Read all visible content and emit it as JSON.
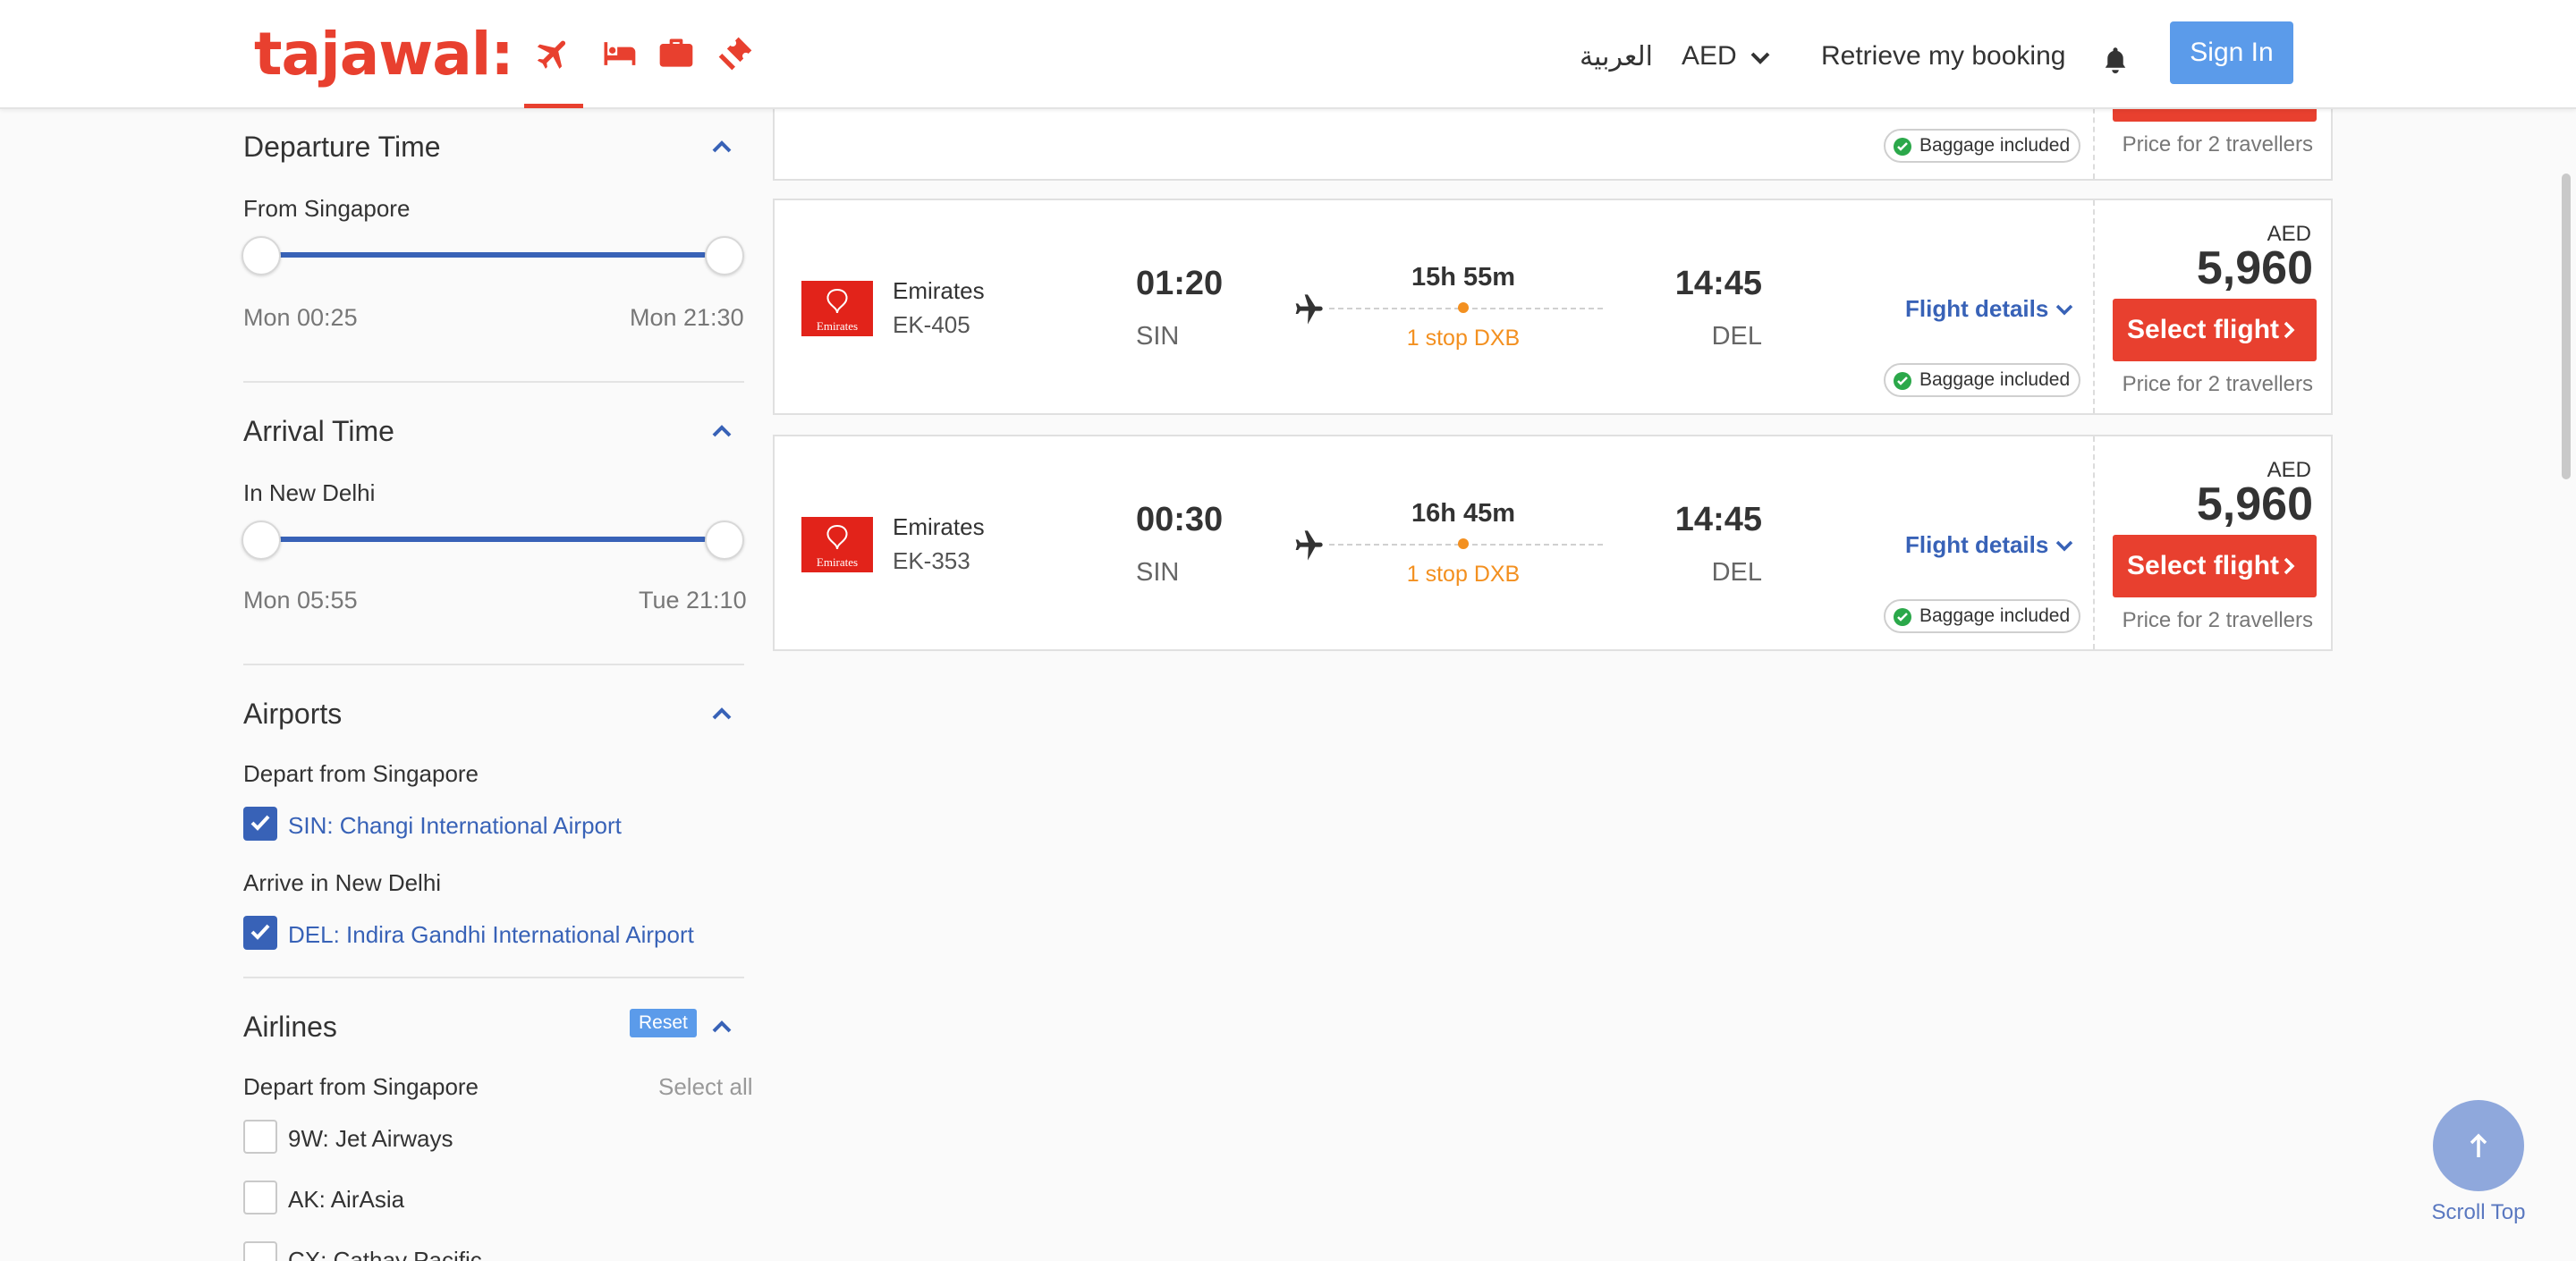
{
  "header": {
    "logo": "tajawal:",
    "language": "العربية",
    "currency": "AED",
    "retrieve": "Retrieve my booking",
    "sign_in": "Sign In"
  },
  "filters": {
    "departure": {
      "title": "Departure Time",
      "sub": "From Singapore",
      "min": "Mon 00:25",
      "max": "Mon 21:30"
    },
    "arrival": {
      "title": "Arrival Time",
      "sub": "In New Delhi",
      "min": "Mon 05:55",
      "max": "Tue 21:10"
    },
    "airports": {
      "title": "Airports",
      "depart_label": "Depart from Singapore",
      "depart_airport": "SIN: Changi International Airport",
      "arrive_label": "Arrive in New Delhi",
      "arrive_airport": "DEL: Indira Gandhi International Airport"
    },
    "airlines": {
      "title": "Airlines",
      "reset": "Reset",
      "depart_label": "Depart from Singapore",
      "select_all": "Select all",
      "items": [
        "9W: Jet Airways",
        "AK: AirAsia",
        "CX: Cathay Pacific"
      ]
    }
  },
  "top_card": {
    "baggage": "Baggage included",
    "price_note": "Price for 2 travellers"
  },
  "flights": [
    {
      "airline": "Emirates",
      "logo_text": "Emirates",
      "flight_no": "EK-405",
      "dep_time": "01:20",
      "dep_code": "SIN",
      "duration": "15h 55m",
      "stops": "1 stop DXB",
      "arr_time": "14:45",
      "arr_code": "DEL",
      "details": "Flight details",
      "baggage": "Baggage included",
      "currency": "AED",
      "price": "5,960",
      "select": "Select flight",
      "price_note": "Price for 2 travellers"
    },
    {
      "airline": "Emirates",
      "logo_text": "Emirates",
      "flight_no": "EK-353",
      "dep_time": "00:30",
      "dep_code": "SIN",
      "duration": "16h 45m",
      "stops": "1 stop DXB",
      "arr_time": "14:45",
      "arr_code": "DEL",
      "details": "Flight details",
      "baggage": "Baggage included",
      "currency": "AED",
      "price": "5,960",
      "select": "Select flight",
      "price_note": "Price for 2 travellers"
    }
  ],
  "scroll_top": "Scroll Top",
  "colors": {
    "brand_red": "#e8402f",
    "link_blue": "#3862b7",
    "accent_blue": "#5b9bea",
    "stop_orange": "#f39020"
  },
  "icons": [
    "flight-icon",
    "hotel-icon",
    "packages-icon",
    "activities-icon",
    "bell-icon",
    "chevron-down-icon",
    "chevron-up-icon",
    "check-icon",
    "plane-icon",
    "arrow-up-icon"
  ]
}
